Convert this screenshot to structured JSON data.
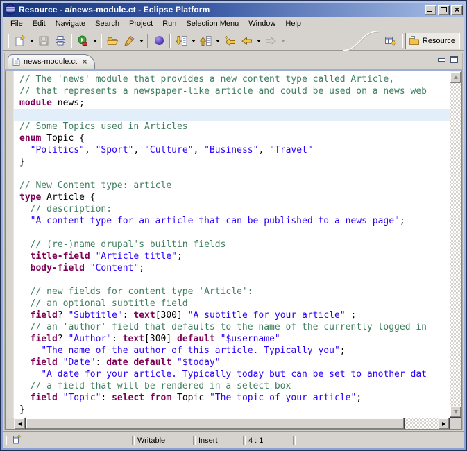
{
  "window": {
    "title": "Resource - a/news-module.ct - Eclipse Platform"
  },
  "icons": {
    "close": "×",
    "titlebar": [
      "eclipse-logo-icon",
      "minimize-icon",
      "maximize-icon",
      "close-icon"
    ],
    "toolbar": [
      "new-wizard-icon",
      "save-icon",
      "print-icon",
      "run-external-tools-icon",
      "open-folder-icon",
      "brush-icon",
      "sphere-icon",
      "next-annotation-icon",
      "previous-annotation-icon",
      "last-edit-location-icon",
      "back-icon",
      "forward-icon"
    ],
    "perspective": [
      "open-perspective-icon",
      "resource-folder-icon"
    ],
    "tab": [
      "document-icon",
      "close-icon"
    ],
    "statusbar": [
      "fast-view-icon"
    ]
  },
  "menu": {
    "items": [
      "File",
      "Edit",
      "Navigate",
      "Search",
      "Project",
      "Run",
      "Selection Menu",
      "Window",
      "Help"
    ]
  },
  "toolbar": {
    "buttons": [
      {
        "name": "new-wizard",
        "dropdown": true,
        "disabled": false
      },
      {
        "name": "save",
        "dropdown": false,
        "disabled": true
      },
      {
        "name": "print",
        "dropdown": false,
        "disabled": false
      },
      {
        "name": "run-external-tools",
        "dropdown": true,
        "disabled": false
      },
      {
        "name": "open-folder",
        "dropdown": false,
        "disabled": false
      },
      {
        "name": "brush",
        "dropdown": true,
        "disabled": false
      },
      {
        "name": "sphere",
        "dropdown": false,
        "disabled": false
      },
      {
        "name": "next-annotation",
        "dropdown": true,
        "disabled": false
      },
      {
        "name": "previous-annotation",
        "dropdown": true,
        "disabled": false
      },
      {
        "name": "last-edit-location",
        "dropdown": false,
        "disabled": false
      },
      {
        "name": "back",
        "dropdown": true,
        "disabled": false
      },
      {
        "name": "forward",
        "dropdown": true,
        "disabled": true
      }
    ]
  },
  "perspective": {
    "current": "Resource"
  },
  "editor_tab": {
    "label": "news-module.ct"
  },
  "editor": {
    "colors": {
      "comment": "#3F7F5F",
      "keyword": "#7F0055",
      "string": "#2A00FF",
      "current_line_bg": "#E3EEFB"
    },
    "cursor": {
      "line": 4,
      "column": 1
    },
    "lines": [
      {
        "seg": [
          [
            "c",
            "// The 'news' module that provides a new content type called Article,"
          ]
        ]
      },
      {
        "seg": [
          [
            "c",
            "// that represents a newspaper-like article and could be used on a news web"
          ]
        ]
      },
      {
        "seg": [
          [
            "k",
            "module"
          ],
          [
            "p",
            " news;"
          ]
        ]
      },
      {
        "current": true,
        "seg": []
      },
      {
        "seg": [
          [
            "c",
            "// Some Topics used in Articles"
          ]
        ]
      },
      {
        "seg": [
          [
            "k",
            "enum"
          ],
          [
            "p",
            " Topic {"
          ]
        ]
      },
      {
        "seg": [
          [
            "p",
            "  "
          ],
          [
            "s",
            "\"Politics\""
          ],
          [
            "p",
            ", "
          ],
          [
            "s",
            "\"Sport\""
          ],
          [
            "p",
            ", "
          ],
          [
            "s",
            "\"Culture\""
          ],
          [
            "p",
            ", "
          ],
          [
            "s",
            "\"Business\""
          ],
          [
            "p",
            ", "
          ],
          [
            "s",
            "\"Travel\""
          ]
        ]
      },
      {
        "seg": [
          [
            "p",
            "}"
          ]
        ]
      },
      {
        "seg": []
      },
      {
        "seg": [
          [
            "c",
            "// New Content type: article"
          ]
        ]
      },
      {
        "seg": [
          [
            "k",
            "type"
          ],
          [
            "p",
            " Article {"
          ]
        ]
      },
      {
        "seg": [
          [
            "p",
            "  "
          ],
          [
            "c",
            "// description:"
          ]
        ]
      },
      {
        "seg": [
          [
            "p",
            "  "
          ],
          [
            "s",
            "\"A content type for an article that can be published to a news page\""
          ],
          [
            "p",
            ";"
          ]
        ]
      },
      {
        "seg": []
      },
      {
        "seg": [
          [
            "p",
            "  "
          ],
          [
            "c",
            "// (re-)name drupal's builtin fields"
          ]
        ]
      },
      {
        "seg": [
          [
            "p",
            "  "
          ],
          [
            "k",
            "title-field"
          ],
          [
            "p",
            " "
          ],
          [
            "s",
            "\"Article title\""
          ],
          [
            "p",
            ";"
          ]
        ]
      },
      {
        "seg": [
          [
            "p",
            "  "
          ],
          [
            "k",
            "body-field"
          ],
          [
            "p",
            " "
          ],
          [
            "s",
            "\"Content\""
          ],
          [
            "p",
            ";"
          ]
        ]
      },
      {
        "seg": []
      },
      {
        "seg": [
          [
            "p",
            "  "
          ],
          [
            "c",
            "// new fields for content type 'Article':"
          ]
        ]
      },
      {
        "seg": [
          [
            "p",
            "  "
          ],
          [
            "c",
            "// an optional subtitle field"
          ]
        ]
      },
      {
        "seg": [
          [
            "p",
            "  "
          ],
          [
            "k",
            "field"
          ],
          [
            "p",
            "? "
          ],
          [
            "s",
            "\"Subtitle\""
          ],
          [
            "p",
            ": "
          ],
          [
            "k",
            "text"
          ],
          [
            "p",
            "[300] "
          ],
          [
            "s",
            "\"A subtitle for your article\""
          ],
          [
            "p",
            " ;"
          ]
        ]
      },
      {
        "seg": [
          [
            "p",
            "  "
          ],
          [
            "c",
            "// an 'author' field that defaults to the name of the currently logged in"
          ]
        ]
      },
      {
        "seg": [
          [
            "p",
            "  "
          ],
          [
            "k",
            "field"
          ],
          [
            "p",
            "? "
          ],
          [
            "s",
            "\"Author\""
          ],
          [
            "p",
            ": "
          ],
          [
            "k",
            "text"
          ],
          [
            "p",
            "[300] "
          ],
          [
            "k",
            "default"
          ],
          [
            "p",
            " "
          ],
          [
            "s",
            "\"$username\""
          ]
        ]
      },
      {
        "seg": [
          [
            "p",
            "    "
          ],
          [
            "s",
            "\"The name of the author of this article. Typically you\""
          ],
          [
            "p",
            ";"
          ]
        ]
      },
      {
        "seg": [
          [
            "p",
            "  "
          ],
          [
            "k",
            "field"
          ],
          [
            "p",
            " "
          ],
          [
            "s",
            "\"Date\""
          ],
          [
            "p",
            ": "
          ],
          [
            "k",
            "date"
          ],
          [
            "p",
            " "
          ],
          [
            "k",
            "default"
          ],
          [
            "p",
            " "
          ],
          [
            "s",
            "\"$today\""
          ]
        ]
      },
      {
        "seg": [
          [
            "p",
            "    "
          ],
          [
            "s",
            "\"A date for your article. Typically today but can be set to another dat"
          ]
        ]
      },
      {
        "seg": [
          [
            "p",
            "  "
          ],
          [
            "c",
            "// a field that will be rendered in a select box"
          ]
        ]
      },
      {
        "seg": [
          [
            "p",
            "  "
          ],
          [
            "k",
            "field"
          ],
          [
            "p",
            " "
          ],
          [
            "s",
            "\"Topic\""
          ],
          [
            "p",
            ": "
          ],
          [
            "k",
            "select"
          ],
          [
            "p",
            " "
          ],
          [
            "k",
            "from"
          ],
          [
            "p",
            " Topic "
          ],
          [
            "s",
            "\"The topic of your article\""
          ],
          [
            "p",
            ";"
          ]
        ]
      },
      {
        "seg": [
          [
            "p",
            "}"
          ]
        ]
      }
    ]
  },
  "statusbar": {
    "writable": "Writable",
    "insert_mode": "Insert",
    "cursor_position": "4 : 1"
  }
}
